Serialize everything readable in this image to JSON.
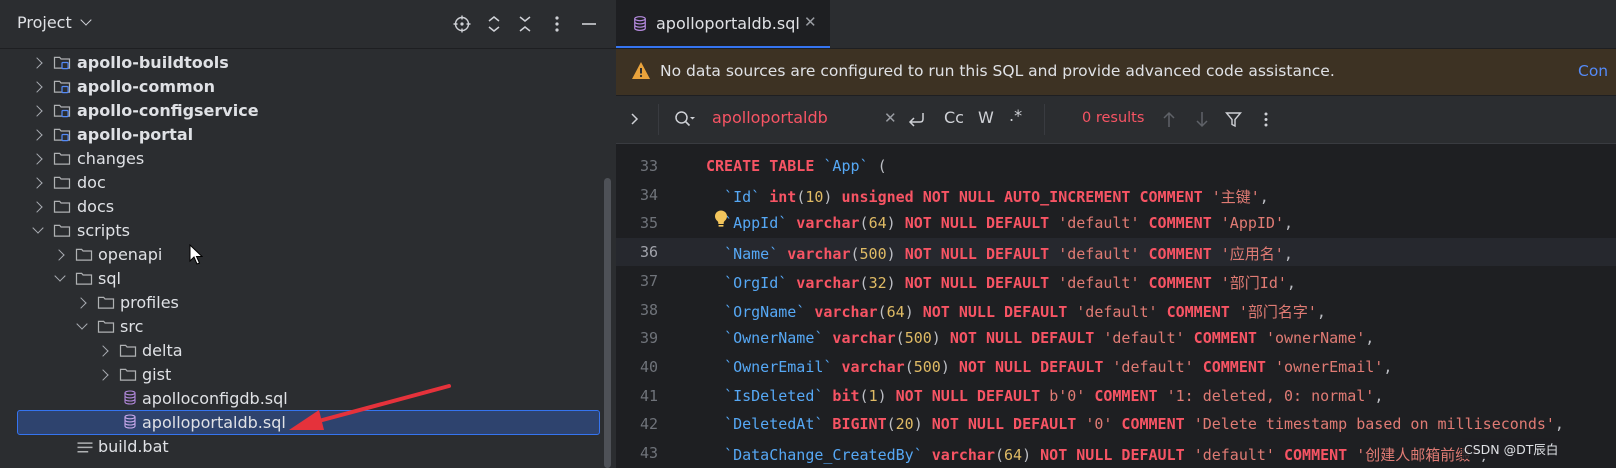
{
  "project_panel": {
    "title": "Project",
    "tree": [
      {
        "label": "apollo-buildtools",
        "type": "module",
        "state": "closed",
        "bold": true
      },
      {
        "label": "apollo-common",
        "type": "module",
        "state": "closed",
        "bold": true
      },
      {
        "label": "apollo-configservice",
        "type": "module",
        "state": "closed",
        "bold": true
      },
      {
        "label": "apollo-portal",
        "type": "module",
        "state": "closed",
        "bold": true
      },
      {
        "label": "changes",
        "type": "folder",
        "state": "closed"
      },
      {
        "label": "doc",
        "type": "folder",
        "state": "closed"
      },
      {
        "label": "docs",
        "type": "folder",
        "state": "closed"
      },
      {
        "label": "scripts",
        "type": "folder",
        "state": "open"
      },
      {
        "label": "openapi",
        "type": "folder",
        "state": "closed"
      },
      {
        "label": "sql",
        "type": "folder",
        "state": "open"
      },
      {
        "label": "profiles",
        "type": "folder",
        "state": "closed"
      },
      {
        "label": "src",
        "type": "folder",
        "state": "open"
      },
      {
        "label": "delta",
        "type": "folder",
        "state": "closed"
      },
      {
        "label": "gist",
        "type": "folder",
        "state": "closed"
      },
      {
        "label": "apolloconfigdb.sql",
        "type": "sqlfile"
      },
      {
        "label": "apolloportaldb.sql",
        "type": "sqlfile",
        "selected": true
      },
      {
        "label": "build.bat",
        "type": "textfile"
      }
    ]
  },
  "editor": {
    "tab_label": "apolloportaldb.sql",
    "banner_message": "No data sources are configured to run this SQL and provide advanced code assistance.",
    "banner_link": "Con",
    "search": {
      "query": "apolloportaldb",
      "match_case": "Cc",
      "words": "W",
      "regex": ".*",
      "results": "0 results"
    },
    "lines": [
      {
        "num": "33",
        "segs": [
          [
            "kw",
            "CREATE TABLE "
          ],
          [
            "id",
            "`App`"
          ],
          [
            "pl",
            " ("
          ]
        ]
      },
      {
        "num": "34",
        "segs": [
          [
            "id",
            "  `Id`"
          ],
          [
            "ty",
            " int"
          ],
          [
            "pl",
            "("
          ],
          [
            "nu",
            "10"
          ],
          [
            "pl",
            ") "
          ],
          [
            "kw",
            "unsigned NOT NULL AUTO_INCREMENT COMMENT "
          ],
          [
            "st",
            "'主键'"
          ],
          [
            "pl",
            ","
          ]
        ]
      },
      {
        "num": "35",
        "segs": [
          [
            "id",
            "  `AppId`"
          ],
          [
            "ty",
            " varchar"
          ],
          [
            "pl",
            "("
          ],
          [
            "nu",
            "64"
          ],
          [
            "pl",
            ") "
          ],
          [
            "kw",
            "NOT NULL DEFAULT "
          ],
          [
            "st",
            "'default'"
          ],
          [
            "kw",
            " COMMENT "
          ],
          [
            "st",
            "'AppID'"
          ],
          [
            "pl",
            ","
          ]
        ]
      },
      {
        "num": "36",
        "segs": [
          [
            "id",
            "  `Name`"
          ],
          [
            "ty",
            " varchar"
          ],
          [
            "pl",
            "("
          ],
          [
            "nu",
            "500"
          ],
          [
            "pl",
            ") "
          ],
          [
            "kw",
            "NOT NULL DEFAULT "
          ],
          [
            "st",
            "'default'"
          ],
          [
            "kw",
            " COMMENT "
          ],
          [
            "st",
            "'应用名'"
          ],
          [
            "pl",
            ","
          ]
        ],
        "current": true
      },
      {
        "num": "37",
        "segs": [
          [
            "id",
            "  `OrgId`"
          ],
          [
            "ty",
            " varchar"
          ],
          [
            "pl",
            "("
          ],
          [
            "nu",
            "32"
          ],
          [
            "pl",
            ") "
          ],
          [
            "kw",
            "NOT NULL DEFAULT "
          ],
          [
            "st",
            "'default'"
          ],
          [
            "kw",
            " COMMENT "
          ],
          [
            "st",
            "'部门Id'"
          ],
          [
            "pl",
            ","
          ]
        ]
      },
      {
        "num": "38",
        "segs": [
          [
            "id",
            "  `OrgName`"
          ],
          [
            "ty",
            " varchar"
          ],
          [
            "pl",
            "("
          ],
          [
            "nu",
            "64"
          ],
          [
            "pl",
            ") "
          ],
          [
            "kw",
            "NOT NULL DEFAULT "
          ],
          [
            "st",
            "'default'"
          ],
          [
            "kw",
            " COMMENT "
          ],
          [
            "st",
            "'部门名字'"
          ],
          [
            "pl",
            ","
          ]
        ]
      },
      {
        "num": "39",
        "segs": [
          [
            "id",
            "  `OwnerName`"
          ],
          [
            "ty",
            " varchar"
          ],
          [
            "pl",
            "("
          ],
          [
            "nu",
            "500"
          ],
          [
            "pl",
            ") "
          ],
          [
            "kw",
            "NOT NULL DEFAULT "
          ],
          [
            "st",
            "'default'"
          ],
          [
            "kw",
            " COMMENT "
          ],
          [
            "st",
            "'ownerName'"
          ],
          [
            "pl",
            ","
          ]
        ]
      },
      {
        "num": "40",
        "segs": [
          [
            "id",
            "  `OwnerEmail`"
          ],
          [
            "ty",
            " varchar"
          ],
          [
            "pl",
            "("
          ],
          [
            "nu",
            "500"
          ],
          [
            "pl",
            ") "
          ],
          [
            "kw",
            "NOT NULL DEFAULT "
          ],
          [
            "st",
            "'default'"
          ],
          [
            "kw",
            " COMMENT "
          ],
          [
            "st",
            "'ownerEmail'"
          ],
          [
            "pl",
            ","
          ]
        ]
      },
      {
        "num": "41",
        "segs": [
          [
            "id",
            "  `IsDeleted`"
          ],
          [
            "ty",
            " bit"
          ],
          [
            "pl",
            "("
          ],
          [
            "nu",
            "1"
          ],
          [
            "pl",
            ") "
          ],
          [
            "kw",
            "NOT NULL DEFAULT "
          ],
          [
            "st",
            "b'0'"
          ],
          [
            "kw",
            " COMMENT "
          ],
          [
            "st",
            "'1: deleted, 0: normal'"
          ],
          [
            "pl",
            ","
          ]
        ]
      },
      {
        "num": "42",
        "segs": [
          [
            "id",
            "  `DeletedAt`"
          ],
          [
            "ty",
            " BIGINT"
          ],
          [
            "pl",
            "("
          ],
          [
            "nu",
            "20"
          ],
          [
            "pl",
            ") "
          ],
          [
            "kw",
            "NOT NULL DEFAULT "
          ],
          [
            "st",
            "'0'"
          ],
          [
            "kw",
            " COMMENT "
          ],
          [
            "st",
            "'Delete timestamp based on milliseconds'"
          ],
          [
            "pl",
            ","
          ]
        ]
      },
      {
        "num": "43",
        "segs": [
          [
            "id",
            "  `DataChange_CreatedBy`"
          ],
          [
            "ty",
            " varchar"
          ],
          [
            "pl",
            "("
          ],
          [
            "nu",
            "64"
          ],
          [
            "pl",
            ") "
          ],
          [
            "kw",
            "NOT NULL DEFAULT "
          ],
          [
            "st",
            "'default'"
          ],
          [
            "kw",
            " COMMENT "
          ],
          [
            "st",
            "'创建人邮箱前缀'"
          ],
          [
            "pl",
            ","
          ]
        ]
      }
    ]
  },
  "watermark": "CSDN @DT辰白",
  "colors": {
    "accent": "#3574f0",
    "keyword": "#f75464",
    "identifier": "#56a8f5",
    "number": "#e0bb65",
    "string": "#e07b74",
    "annotation_arrow": "#e5323b"
  }
}
